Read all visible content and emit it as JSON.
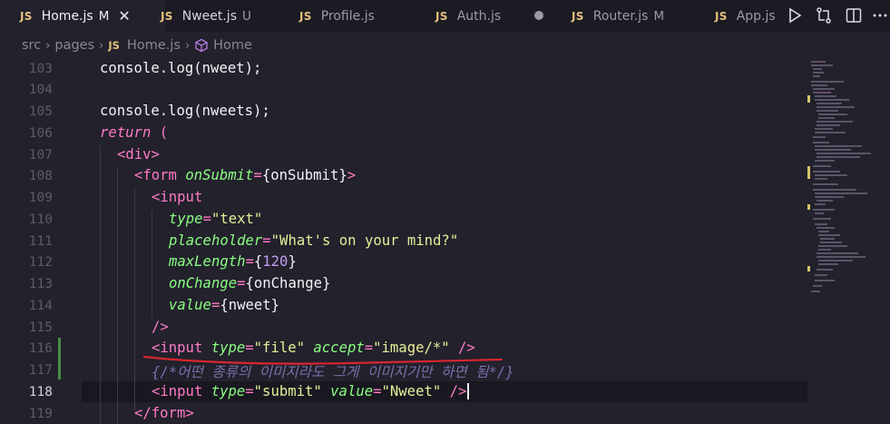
{
  "tabs": [
    {
      "label": "Home.js",
      "status": "M",
      "active": true
    },
    {
      "label": "Nweet.js",
      "status": "U"
    },
    {
      "label": "Profile.js",
      "status": ""
    },
    {
      "label": "Auth.js",
      "status": ""
    },
    {
      "label": "Router.js",
      "status": "M"
    },
    {
      "label": "App.js",
      "status": ""
    }
  ],
  "tab_prefix": "JS",
  "breadcrumb": {
    "seg1": "src",
    "seg2": "pages",
    "seg3": "Home.js",
    "seg4": "Home"
  },
  "lines": {
    "n103": "103",
    "n104": "104",
    "n105": "105",
    "n106": "106",
    "n107": "107",
    "n108": "108",
    "n109": "109",
    "n110": "110",
    "n111": "111",
    "n112": "112",
    "n113": "113",
    "n114": "114",
    "n115": "115",
    "n116": "116",
    "n117": "117",
    "n118": "118",
    "n119": "119"
  },
  "code": {
    "l103": {
      "a": "console.log(",
      "b": "nweet",
      "c": ");"
    },
    "l105": {
      "a": "console.log(",
      "b": "nweets",
      "c": ");"
    },
    "l106": {
      "kw": "return",
      "p": " ("
    },
    "l107": {
      "t": "<div>"
    },
    "l108": {
      "a": "<form ",
      "attr": "onSubmit",
      "eq": "=",
      "v": "{onSubmit}",
      "c": ">"
    },
    "l109": {
      "t": "<input"
    },
    "l110": {
      "attr": "type",
      "eq": "=",
      "v": "\"text\""
    },
    "l111": {
      "attr": "placeholder",
      "eq": "=",
      "v": "\"What's on your mind?\""
    },
    "l112": {
      "attr": "maxLength",
      "eq": "=",
      "o": "{",
      "v": "120",
      "c": "}"
    },
    "l113": {
      "attr": "onChange",
      "eq": "=",
      "v": "{onChange}"
    },
    "l114": {
      "attr": "value",
      "eq": "=",
      "v": "{nweet}"
    },
    "l115": {
      "t": "/>"
    },
    "l116": {
      "a": "<input ",
      "attr1": "type",
      "eq": "=",
      "v1": "\"file\"",
      "attr2": "accept",
      "v2": "\"image/*\"",
      "c": " />"
    },
    "l117": {
      "t": "{/*어떤 종류의 이미지라도 그게 이미지기만 하면 됨*/}"
    },
    "l118": {
      "a": "<input ",
      "attr1": "type",
      "eq": "=",
      "v1": "\"submit\"",
      "attr2": "value",
      "v2": "\"Nweet\"",
      "c": " />"
    },
    "l119": {
      "t": "</form>"
    }
  },
  "colors": {
    "background": "#22212c",
    "annotation": "#d9262e",
    "modified_gutter": "#4c8c4a"
  }
}
